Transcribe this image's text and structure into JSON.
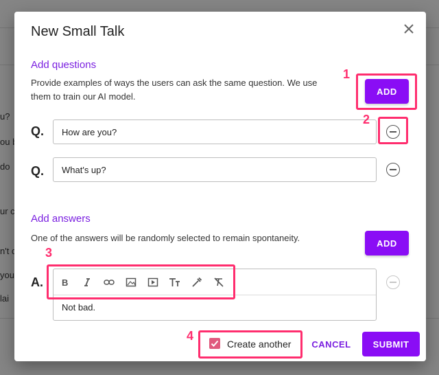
{
  "background": {
    "fragments": [
      "u?",
      "ou b",
      "do",
      "ur c",
      "n't c",
      "you.",
      "lai"
    ]
  },
  "dialog": {
    "title": "New Small Talk",
    "close_icon": "close-icon"
  },
  "questions": {
    "section_title": "Add questions",
    "description_line1": "Provide examples of ways the users can ask the same question. We use",
    "description_line2": "them to train our AI model.",
    "add_label": "ADD",
    "items": [
      {
        "label": "Q.",
        "value": "How are you?"
      },
      {
        "label": "Q.",
        "value": "What's up?"
      }
    ]
  },
  "answers": {
    "section_title": "Add answers",
    "description": "One of the answers will be randomly selected to remain spontaneity.",
    "add_label": "ADD",
    "label": "A.",
    "text": "Not bad.",
    "toolbar": [
      "bold-icon",
      "italic-icon",
      "link-icon",
      "image-icon",
      "video-icon",
      "text-size-icon",
      "color-picker-icon",
      "clear-format-icon"
    ]
  },
  "footer": {
    "create_another_label": "Create another",
    "create_another_checked": true,
    "cancel_label": "CANCEL",
    "submit_label": "SUBMIT"
  },
  "annotations": [
    "1",
    "2",
    "3",
    "4"
  ],
  "colors": {
    "accent": "#8a0df5",
    "section_title": "#7a1fe0",
    "annotation": "#ff2d6e",
    "checkbox": "#e05a7e"
  }
}
